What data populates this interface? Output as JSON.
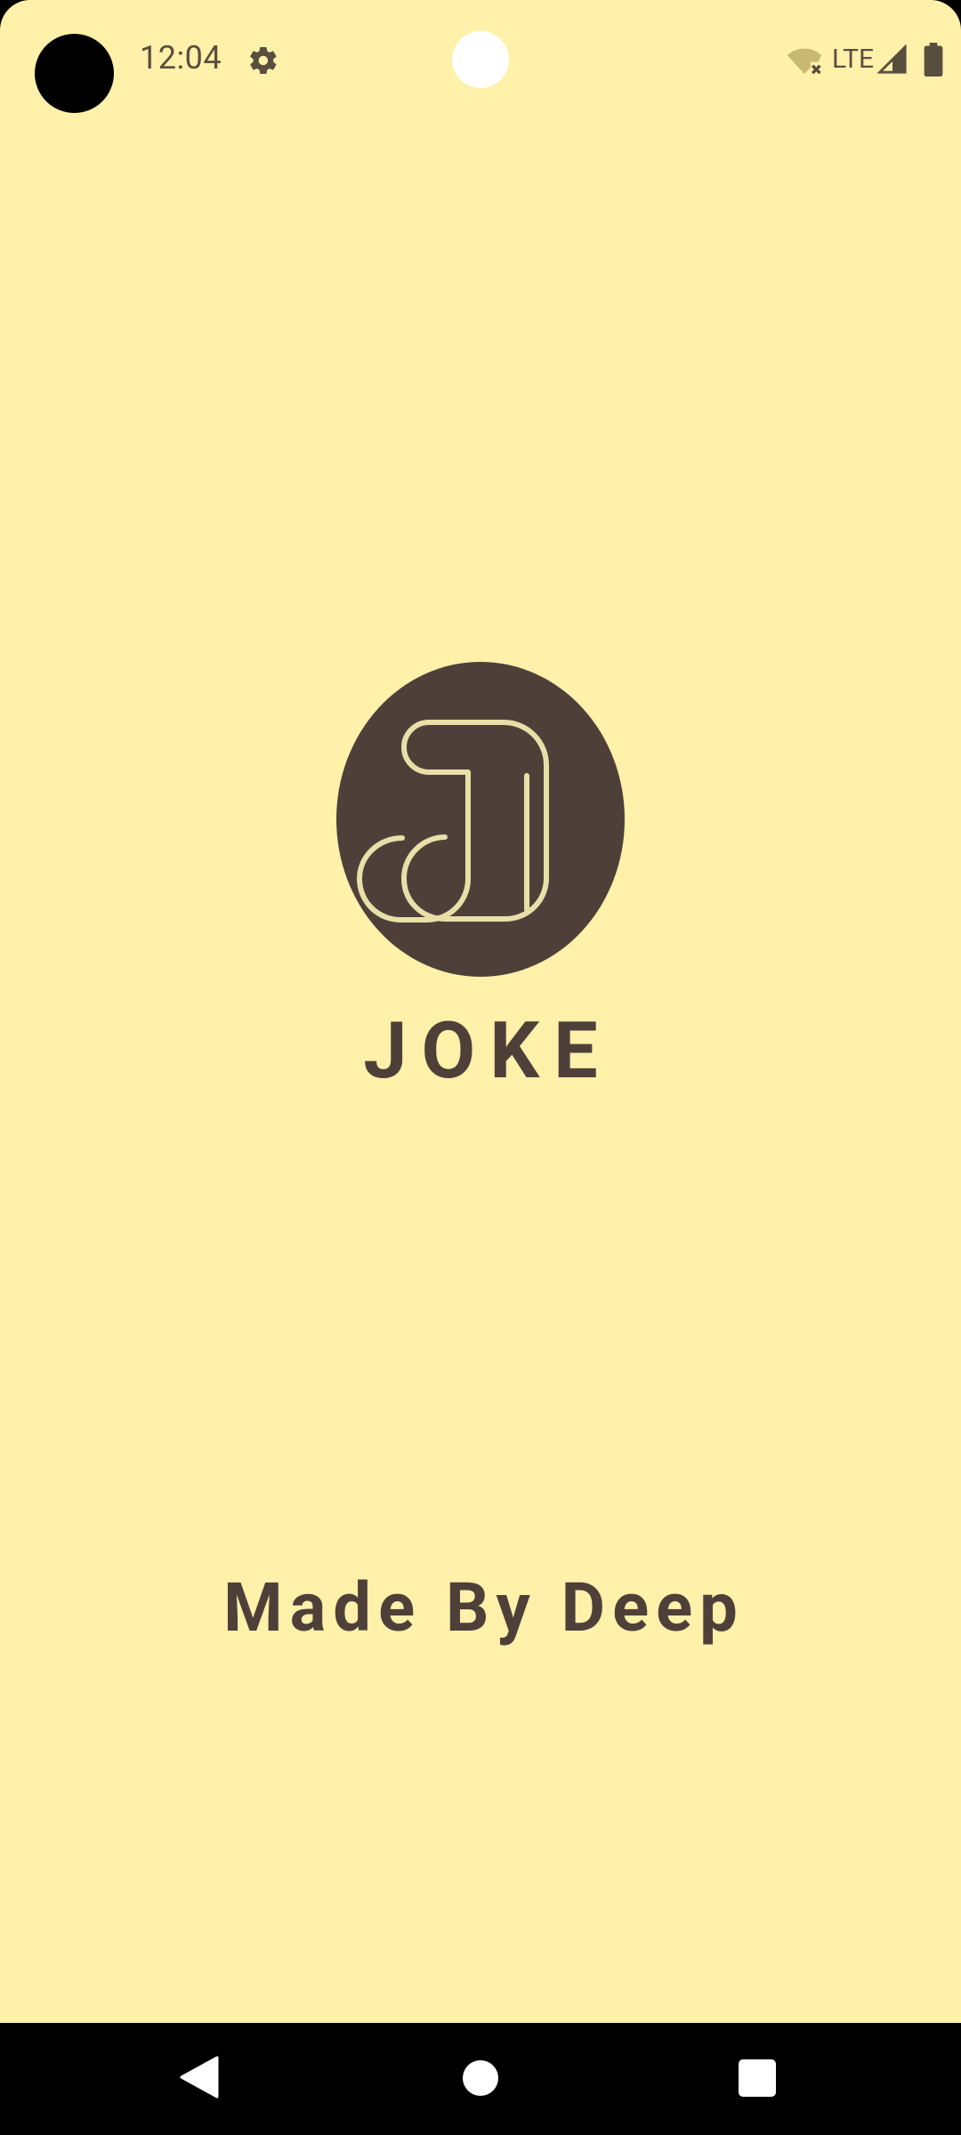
{
  "status_bar": {
    "time": "12:04",
    "network_label": "LTE",
    "icons": [
      "settings-gear-icon",
      "wifi-no-internet-icon",
      "cell-signal-icon",
      "battery-icon"
    ]
  },
  "splash": {
    "logo_text": "JOKE",
    "credit": "Made By Deep"
  },
  "navigation": {
    "buttons": [
      "back",
      "home",
      "recents"
    ]
  },
  "colors": {
    "background": "#fff0aa",
    "brand_dark": "#4e4039",
    "logo_stroke": "#e8e0a8",
    "status_text": "#5a4e3e"
  }
}
